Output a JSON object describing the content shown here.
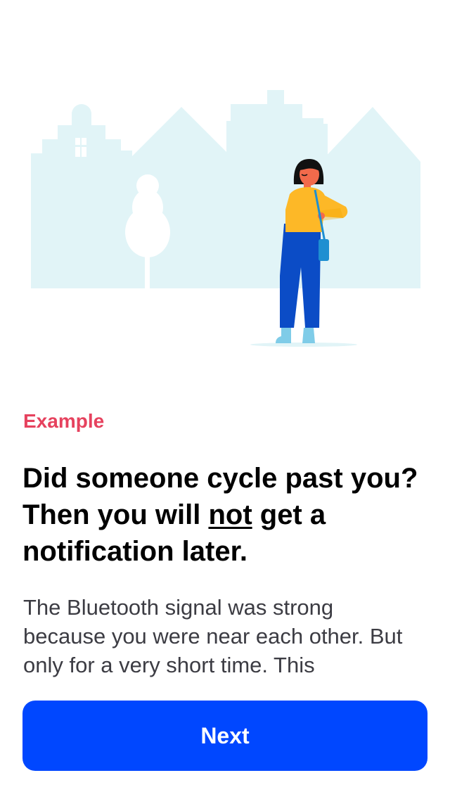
{
  "content": {
    "eyebrow": "Example",
    "headline_part1": "Did someone cycle past you? Then you will ",
    "headline_emphasis": "not",
    "headline_part2": " get a notification later.",
    "body": "The Bluetooth signal was strong because you were near each other. But only for a very short time. This"
  },
  "actions": {
    "next_label": "Next"
  },
  "colors": {
    "accent": "#e6425e",
    "primary_button": "#0047ff",
    "illustration_bg": "#e1f4f7",
    "jacket": "#fdb827",
    "pants": "#0b4cc6",
    "bag": "#1e8fd1",
    "shoes": "#7fcce8"
  },
  "illustration": {
    "name": "woman-standing-in-street-illustration"
  }
}
